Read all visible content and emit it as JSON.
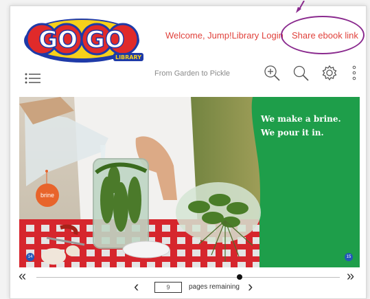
{
  "logo": {
    "text_top": "GO GO",
    "text_sub": "LIBRARY"
  },
  "header": {
    "welcome": "Welcome, Jump!Library",
    "login": "Login",
    "share": "Share ebook link"
  },
  "toolbar": {
    "title": "From Garden to Pickle",
    "icons": [
      "menu-icon",
      "zoom-in-icon",
      "search-icon",
      "gear-icon",
      "more-vertical-icon"
    ]
  },
  "page": {
    "line1": "We make a brine.",
    "line2": "We pour it in.",
    "badge": "brine",
    "left_number": "14",
    "right_number": "15"
  },
  "navigation": {
    "first": "«",
    "last": "»",
    "prev": "‹",
    "next": "›",
    "pages_value": "9",
    "pages_label": "pages remaining",
    "progress": 0.67
  },
  "colors": {
    "accent": "#e0413b",
    "annotation": "#8a2a8e",
    "page_green": "#1e9e4a"
  }
}
